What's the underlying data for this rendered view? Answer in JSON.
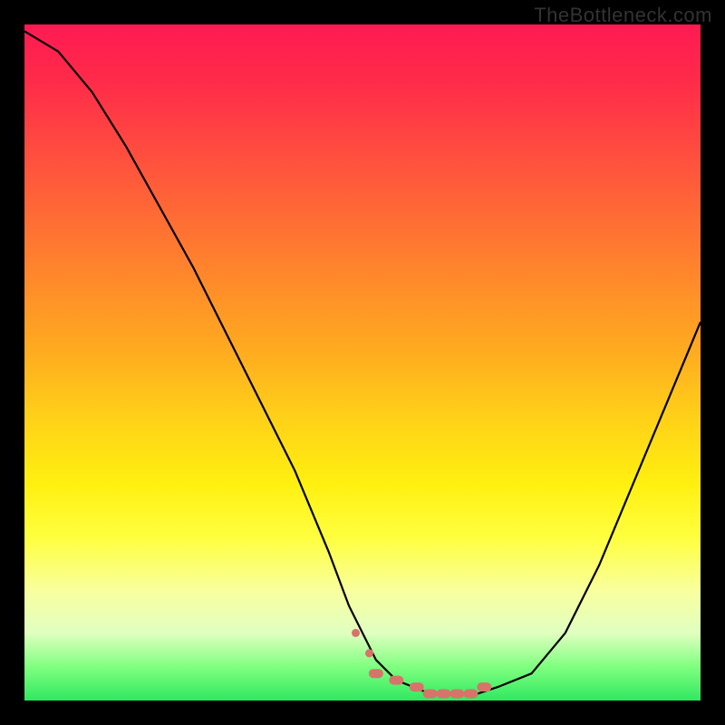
{
  "watermark": "TheBottleneck.com",
  "chart_data": {
    "type": "line",
    "title": "",
    "xlabel": "",
    "ylabel": "",
    "xlim": [
      0,
      100
    ],
    "ylim": [
      0,
      100
    ],
    "curve": {
      "x": [
        0,
        5,
        10,
        15,
        20,
        25,
        30,
        35,
        40,
        45,
        48,
        52,
        55,
        60,
        63,
        67,
        70,
        75,
        80,
        85,
        90,
        95,
        100
      ],
      "y": [
        99,
        96,
        90,
        82,
        73,
        64,
        54,
        44,
        34,
        22,
        14,
        6,
        3,
        1,
        1,
        1,
        2,
        4,
        10,
        20,
        32,
        44,
        56
      ]
    },
    "optimal_markers_x": [
      52,
      55,
      58,
      60,
      62,
      64,
      66,
      68
    ],
    "optimal_markers_y": [
      4,
      3,
      2,
      1,
      1,
      1,
      1,
      2
    ],
    "marker_color": "#d8736a",
    "curve_color": "#000000"
  }
}
